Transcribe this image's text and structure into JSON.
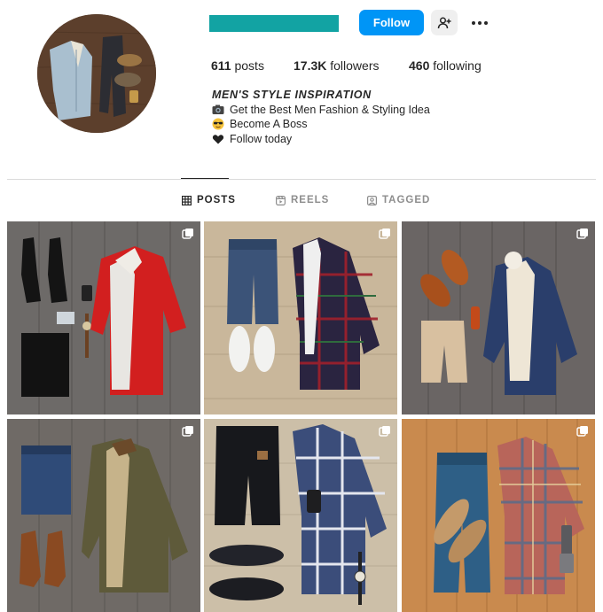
{
  "profile": {
    "avatar_icon": "avatar",
    "username_color": "#12a3a3",
    "follow_label": "Follow",
    "suggest_icon": "add-person-icon",
    "more_icon": "more-options-icon"
  },
  "stats": {
    "posts_count": "611",
    "posts_label": "posts",
    "followers_count": "17.3K",
    "followers_label": "followers",
    "following_count": "460",
    "following_label": "following"
  },
  "bio": {
    "title": "MEN'S STYLE INSPIRATION",
    "lines": [
      {
        "icon": "camera-emoji",
        "text": "Get the Best Men Fashion & Styling Idea"
      },
      {
        "icon": "sunglasses-emoji",
        "text": "Become A Boss"
      },
      {
        "icon": "black-heart-emoji",
        "text": "Follow today"
      }
    ]
  },
  "tabs": [
    {
      "label": "POSTS",
      "icon": "grid-icon",
      "active": true
    },
    {
      "label": "REELS",
      "icon": "reels-icon",
      "active": false
    },
    {
      "label": "TAGGED",
      "icon": "tagged-icon",
      "active": false
    }
  ],
  "posts": [
    {
      "icon": "carousel-icon",
      "background": "wood-gray",
      "accent": "#d21f1f"
    },
    {
      "icon": "carousel-icon",
      "background": "wood-light",
      "accent": "#2a2440"
    },
    {
      "icon": "carousel-icon",
      "background": "wood-gray",
      "accent": "#2a3e6b"
    },
    {
      "icon": "carousel-icon",
      "background": "wood-gray",
      "accent": "#5e5a3a"
    },
    {
      "icon": "carousel-icon",
      "background": "wood-light",
      "accent": "#3b4d7a"
    },
    {
      "icon": "carousel-icon",
      "background": "wood-orange",
      "accent": "#b8655a"
    }
  ],
  "colors": {
    "accent": "#0095f6",
    "text": "#262626",
    "muted": "#8e8e8e",
    "divider": "#dbdbdb"
  }
}
